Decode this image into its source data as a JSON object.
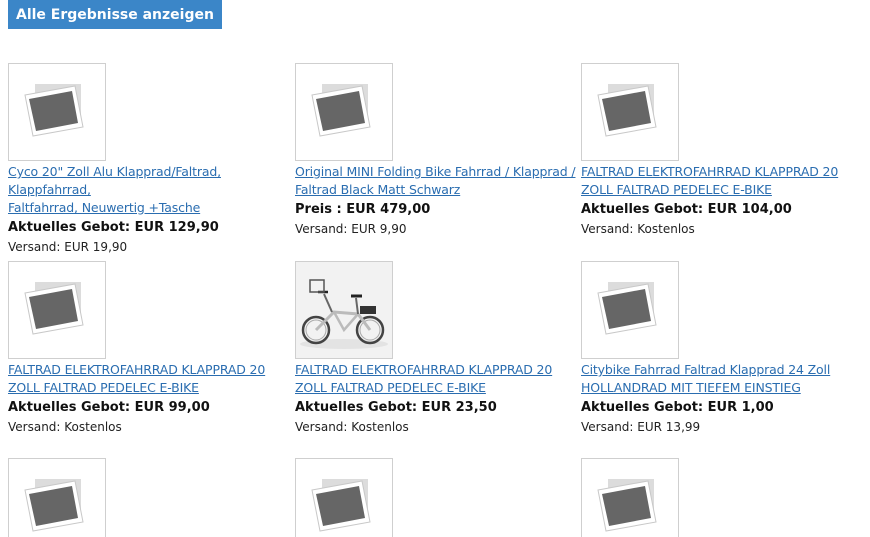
{
  "header": {
    "show_all_label": "Alle Ergebnisse anzeigen"
  },
  "items": [
    {
      "title_line1": "Cyco 20\" Zoll Alu Klapprad/Faltrad, Klappfahrrad,",
      "title_line2": "Faltfahrrad, Neuwertig +Tasche",
      "price": "Aktuelles Gebot: EUR 129,90",
      "shipping": "Versand: EUR 19,90",
      "image": "placeholder-icon"
    },
    {
      "title_line1": "Original MINI Folding Bike Fahrrad / Klapprad /",
      "title_line2": "Faltrad Black Matt Schwarz",
      "price": "Preis : EUR 479,00",
      "shipping": "Versand: EUR 9,90",
      "image": "placeholder-icon"
    },
    {
      "title_line1": "FALTRAD ELEKTROFAHRRAD KLAPPRAD 20",
      "title_line2": "ZOLL FALTRAD PEDELEC E-BIKE",
      "price": "Aktuelles Gebot: EUR 104,00",
      "shipping": "Versand: Kostenlos",
      "image": "placeholder-icon"
    },
    {
      "title_line1": "FALTRAD ELEKTROFAHRRAD KLAPPRAD 20",
      "title_line2": "ZOLL FALTRAD PEDELEC E-BIKE",
      "price": "Aktuelles Gebot: EUR 99,00",
      "shipping": "Versand: Kostenlos",
      "image": "placeholder-icon"
    },
    {
      "title_line1": "FALTRAD ELEKTROFAHRRAD KLAPPRAD 20",
      "title_line2": "ZOLL FALTRAD PEDELEC E-BIKE",
      "price": "Aktuelles Gebot: EUR 23,50",
      "shipping": "Versand: Kostenlos",
      "image": "bicycle-photo"
    },
    {
      "title_line1": "Citybike Fahrrad Faltrad Klapprad 24 Zoll",
      "title_line2": "HOLLANDRAD MIT TIEFEM EINSTIEG",
      "price": "Aktuelles Gebot: EUR 1,00",
      "shipping": "Versand: EUR 13,99",
      "image": "placeholder-icon"
    },
    {
      "image": "placeholder-icon"
    },
    {
      "image": "placeholder-icon"
    },
    {
      "image": "placeholder-icon"
    }
  ],
  "colors": {
    "button_bg": "#3b86c8",
    "link": "#2a6db0",
    "thumb_border": "#cfcfcf"
  }
}
